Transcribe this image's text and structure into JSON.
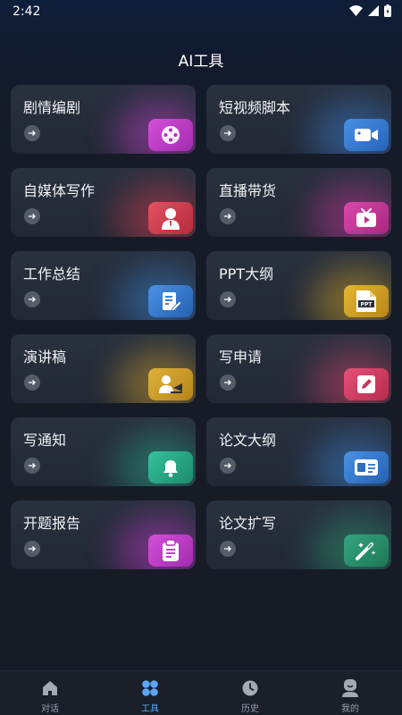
{
  "status": {
    "time": "2:42"
  },
  "title": "AI工具",
  "cards": [
    {
      "label": "剧情编剧",
      "icon": "film-reel-icon",
      "color": "#c843cf"
    },
    {
      "label": "短视频脚本",
      "icon": "video-camera-icon",
      "color": "#3f82d8"
    },
    {
      "label": "自媒体写作",
      "icon": "person-avatar-icon",
      "color": "#d94050"
    },
    {
      "label": "直播带货",
      "icon": "live-tv-icon",
      "color": "#cf3a9e"
    },
    {
      "label": "工作总结",
      "icon": "edit-document-icon",
      "color": "#3d86d6"
    },
    {
      "label": "PPT大纲",
      "icon": "ppt-file-icon",
      "color": "#d9a826"
    },
    {
      "label": "演讲稿",
      "icon": "presenter-icon",
      "color": "#d4a52c"
    },
    {
      "label": "写申请",
      "icon": "pen-note-icon",
      "color": "#d9476a"
    },
    {
      "label": "写通知",
      "icon": "bell-icon",
      "color": "#2dab8a"
    },
    {
      "label": "论文大纲",
      "icon": "card-outline-icon",
      "color": "#3d86d6"
    },
    {
      "label": "开题报告",
      "icon": "clipboard-icon",
      "color": "#c83bcf"
    },
    {
      "label": "论文扩写",
      "icon": "magic-wand-icon",
      "color": "#2e9d76"
    }
  ],
  "tabs": [
    {
      "label": "对话",
      "icon": "home-icon",
      "active": false
    },
    {
      "label": "工具",
      "icon": "grid-tools-icon",
      "active": true
    },
    {
      "label": "历史",
      "icon": "clock-icon",
      "active": false
    },
    {
      "label": "我的",
      "icon": "profile-icon",
      "active": false
    }
  ],
  "colors": {
    "accent": "#5aa7f5",
    "card_bg": "#262d3a",
    "tab_inactive": "#9aa0ab"
  }
}
